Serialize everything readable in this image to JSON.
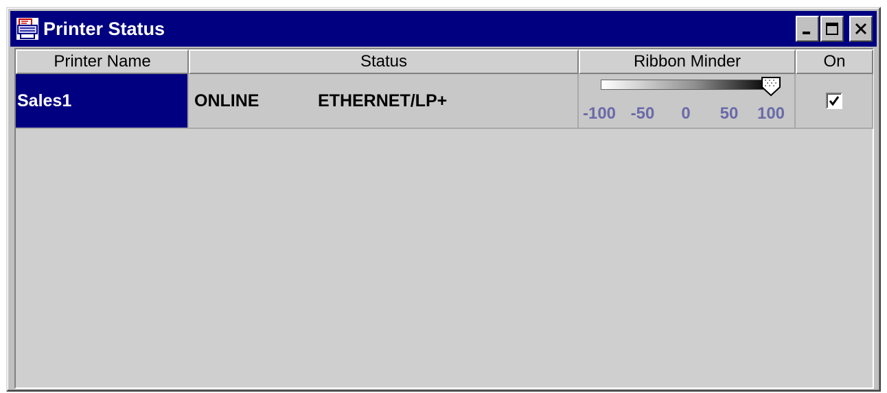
{
  "window": {
    "title": "Printer Status",
    "icon": "printer-icon",
    "controls": [
      "minimize-icon",
      "maximize-icon",
      "close-icon"
    ]
  },
  "table": {
    "columns": [
      "Printer Name",
      "Status",
      "Ribbon Minder",
      "On"
    ],
    "rows": [
      {
        "printer_name": "Sales1",
        "status": "ONLINE",
        "connection": "ETHERNET/LP+",
        "ribbon_minder_value": 100,
        "on": true
      }
    ]
  },
  "slider": {
    "min": -100,
    "max": 100,
    "tick_labels": [
      "-100",
      "-50",
      "0",
      "50",
      "100"
    ]
  },
  "colors": {
    "titlebar": "#000080",
    "selection": "#000080",
    "tick_label": "#6a6aa8"
  }
}
